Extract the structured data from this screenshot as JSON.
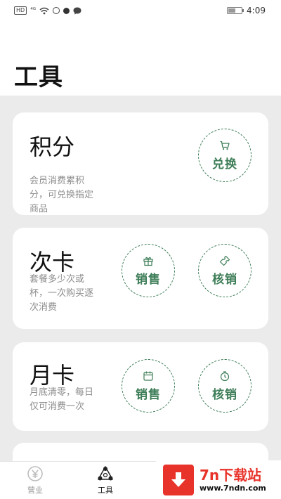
{
  "status_bar": {
    "hd": "HD",
    "signal": "⁴ᴳ",
    "time": "4:09",
    "battery_level": 0.5
  },
  "page": {
    "title": "工具"
  },
  "cards": [
    {
      "title": "积分",
      "description": "会员消费累积分，可兑换指定商品",
      "actions": [
        {
          "label": "兑换",
          "icon": "cart-icon"
        }
      ]
    },
    {
      "title": "次卡",
      "description": "套餐多少次或杯，一次购买逐次消费",
      "actions": [
        {
          "label": "销售",
          "icon": "gift-icon"
        },
        {
          "label": "核销",
          "icon": "ticket-icon"
        }
      ]
    },
    {
      "title": "月卡",
      "description": "月底清零，每日仅可消费一次",
      "actions": [
        {
          "label": "销售",
          "icon": "calendar-icon"
        },
        {
          "label": "核销",
          "icon": "timer-icon"
        }
      ]
    }
  ],
  "bottom_nav": {
    "items": [
      {
        "label": "营业",
        "icon": "yen-icon",
        "active": false
      },
      {
        "label": "工具",
        "icon": "tools-icon",
        "active": true
      }
    ]
  },
  "watermark": {
    "name": "7n下载站",
    "url": "www.7ndn.com"
  },
  "colors": {
    "accent": "#3d7d57",
    "background": "#ebebeb",
    "watermark": "#e8332b"
  }
}
